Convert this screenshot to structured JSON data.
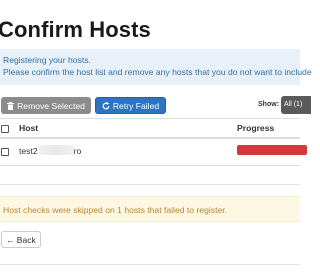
{
  "page": {
    "title": "Confirm Hosts"
  },
  "info": {
    "line1": "Registering your hosts.",
    "line2": "Please confirm the host list and remove any hosts that you do not want to include"
  },
  "toolbar": {
    "remove_label": "Remove Selected",
    "retry_label": "Retry Failed",
    "show_label": "Show:",
    "show_value": "All (1)"
  },
  "table": {
    "headers": {
      "host": "Host",
      "progress": "Progress"
    },
    "rows": [
      {
        "host_prefix": "test2",
        "host_suffix": "ro",
        "progress_status": "failed",
        "progress_color": "#d2393b"
      }
    ]
  },
  "warning": {
    "text": "Host checks were skipped on 1 hosts that failed to register."
  },
  "footer": {
    "back_label": "Back"
  },
  "colors": {
    "info_bg": "#e8f1f9",
    "info_text": "#2f6f9f",
    "retry_button": "#2f73c2",
    "remove_button": "#8c8c8c",
    "warning_bg": "#fcf8e3",
    "warning_text": "#b8862f",
    "progress_failed": "#d2393b"
  },
  "icons": {
    "remove": "trash-icon",
    "retry": "refresh-icon",
    "back": "arrow-left-icon"
  }
}
